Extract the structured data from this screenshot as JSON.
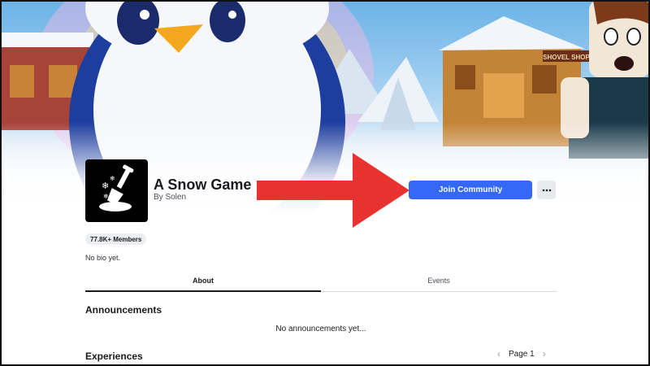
{
  "group": {
    "name": "A Snow Game",
    "byline_prefix": "By",
    "owner": "Solen",
    "members_badge": "77.8K+ Members",
    "bio": "No bio yet."
  },
  "actions": {
    "join_label": "Join Community",
    "more_label": "···"
  },
  "tabs": [
    {
      "label": "About",
      "active": true
    },
    {
      "label": "Events",
      "active": false
    }
  ],
  "sections": {
    "announcements_title": "Announcements",
    "announcements_empty": "No announcements yet...",
    "experiences_title": "Experiences"
  },
  "pager": {
    "label": "Page 1",
    "prev_icon": "‹",
    "next_icon": "›"
  },
  "banner": {
    "shop_sign": "SHOVEL SHOP"
  },
  "colors": {
    "accent": "#3569f5",
    "arrow": "#e8322f"
  },
  "icons": [
    "snow-shovel-icon",
    "more-options-icon",
    "chevron-left-icon",
    "chevron-right-icon"
  ]
}
